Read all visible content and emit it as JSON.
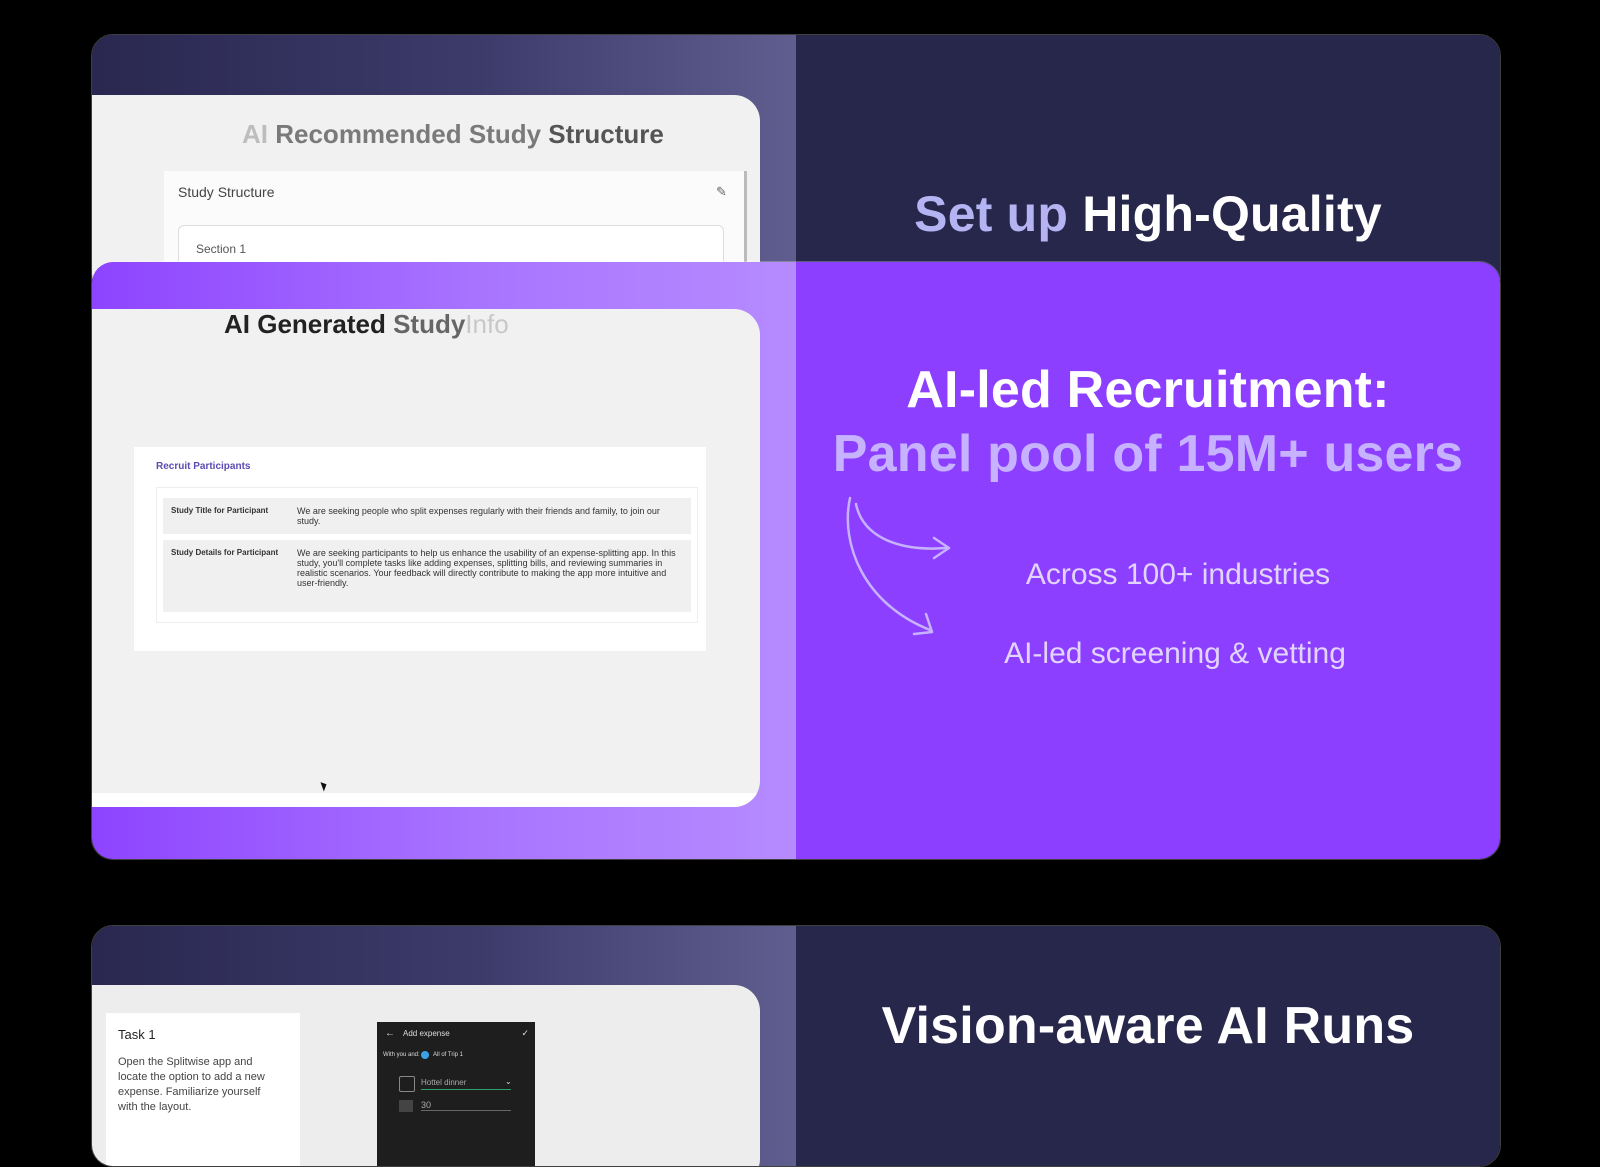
{
  "card1": {
    "screenshot": {
      "heading_dim": "AI",
      "heading_mid": "Recommended Study",
      "heading_dark": "Structure",
      "panel_title": "Study Structure",
      "section_label": "Section 1"
    },
    "headline_accent": "Set up",
    "headline_main": "High-Quality"
  },
  "card2": {
    "screenshot": {
      "heading_dark": "AI Generated",
      "heading_mid": "Study",
      "heading_dim": "Info",
      "panel_title": "Recruit Participants",
      "rows": [
        {
          "label": "Study Title for Participant",
          "value": "We are seeking people who split expenses regularly with their friends and family, to join our study."
        },
        {
          "label": "Study Details for Participant",
          "value": "We are seeking participants to help us enhance the usability of an expense-splitting app. In this study, you'll complete tasks like adding expenses, splitting bills, and reviewing summaries in realistic scenarios. Your feedback will directly contribute to making the app more intuitive and user-friendly."
        }
      ]
    },
    "headline_line1": "AI-led Recruitment:",
    "headline_line2": "Panel pool of 15M+ users",
    "bullets": [
      "Across 100+ industries",
      "AI-led screening & vetting"
    ]
  },
  "card3": {
    "screenshot": {
      "task_title": "Task 1",
      "task_body": "Open the Splitwise app and locate the option to add a new expense. Familiarize yourself with the layout.",
      "phone_title": "Add expense",
      "phone_with": "With you and:",
      "phone_group": "All of Trip 1",
      "phone_desc": "Hottel dinner",
      "phone_amount": "30"
    },
    "headline_line1": "Vision-aware AI Runs"
  }
}
